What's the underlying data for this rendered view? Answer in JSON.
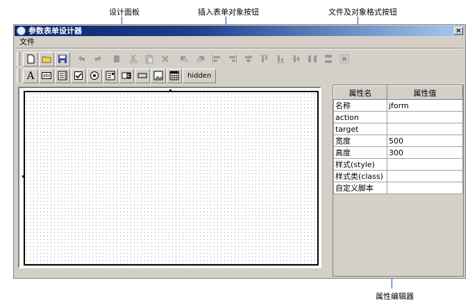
{
  "callouts": {
    "design_panel": "设计面板",
    "insert_buttons": "插入表单对象按钮",
    "format_buttons": "文件及对象格式按钮",
    "property_editor": "属性编辑器"
  },
  "window": {
    "title": "参数表单设计器",
    "close_glyph": "×"
  },
  "menu": {
    "file": "文件"
  },
  "toolbar2": {
    "text_tool": "A",
    "textbox_tool": "abl",
    "hidden_button": "hidden"
  },
  "properties": {
    "header_name": "属性名",
    "header_value": "属性值",
    "rows": [
      {
        "name": "名称",
        "value": "jform"
      },
      {
        "name": "action",
        "value": ""
      },
      {
        "name": "target",
        "value": ""
      },
      {
        "name": "宽度",
        "value": "500"
      },
      {
        "name": "高度",
        "value": "300"
      },
      {
        "name": "样式(style)",
        "value": ""
      },
      {
        "name": "样式类(class)",
        "value": ""
      },
      {
        "name": "自定义脚本",
        "value": ""
      }
    ]
  },
  "colors": {
    "title_start": "#0a246a",
    "title_end": "#a6caf0",
    "callout_line": "#1f3fbf",
    "face": "#d4d0c8"
  }
}
